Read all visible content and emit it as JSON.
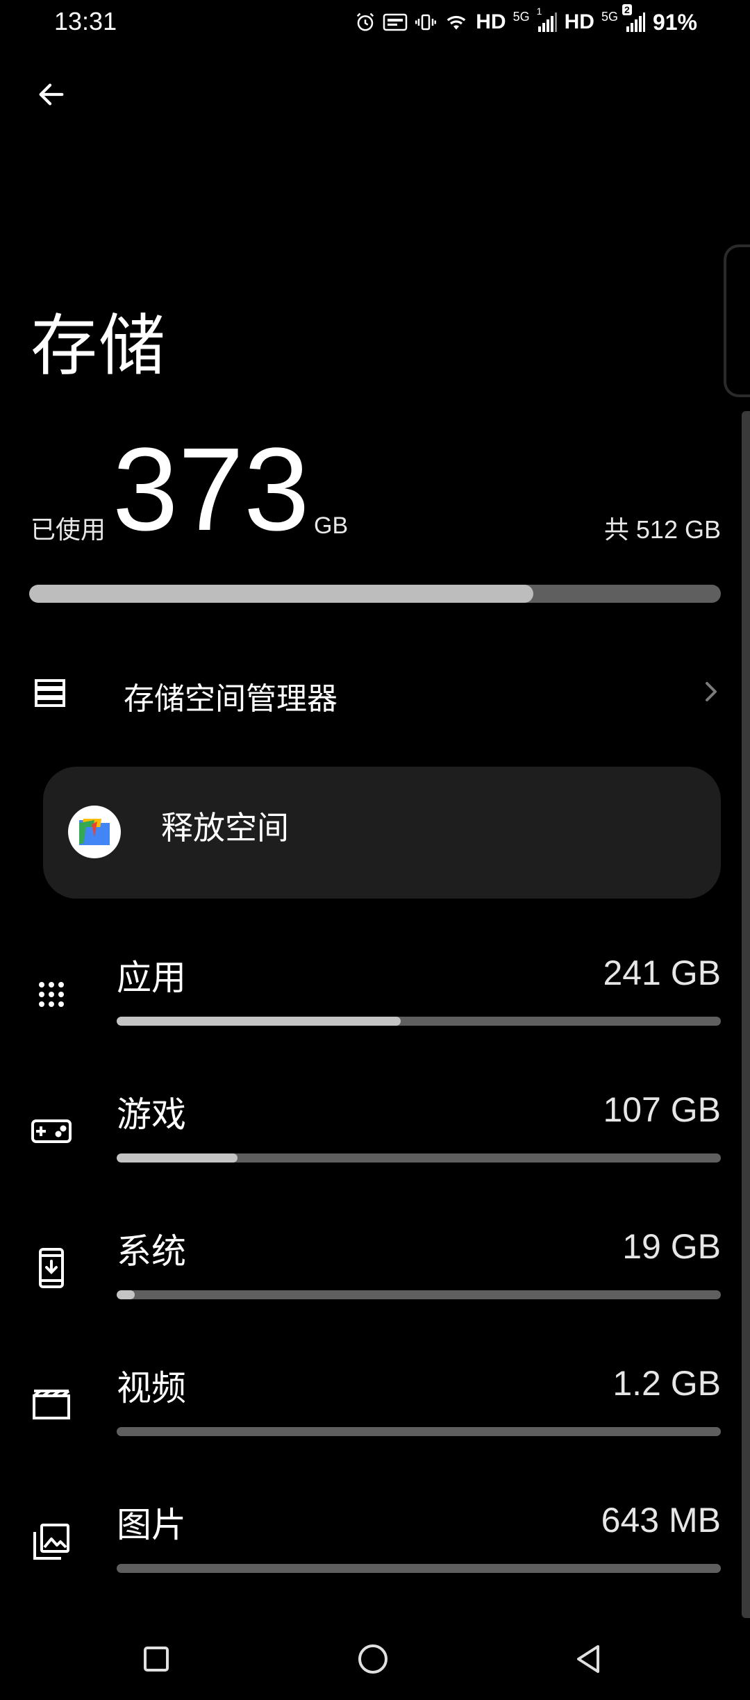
{
  "status_bar": {
    "time": "13:31",
    "hd1": "HD",
    "net1": "5G",
    "sim1": "1",
    "hd2": "HD",
    "net2": "5G",
    "sim2": "2",
    "battery": "91%"
  },
  "header": {
    "title": "存储"
  },
  "summary": {
    "used_label": "已使用",
    "used_value": "373",
    "used_unit": "GB",
    "total_label": "共 512 GB",
    "used_fraction": 0.7285
  },
  "manager": {
    "label": "存储空间管理器"
  },
  "free_space": {
    "label": "释放空间"
  },
  "categories": [
    {
      "label": "应用",
      "value": "241 GB",
      "fraction": 0.47,
      "icon": "apps-grid-icon"
    },
    {
      "label": "游戏",
      "value": "107 GB",
      "fraction": 0.2,
      "icon": "gamepad-icon"
    },
    {
      "label": "系统",
      "value": "19 GB",
      "fraction": 0.03,
      "icon": "system-update-icon"
    },
    {
      "label": "视频",
      "value": "1.2 GB",
      "fraction": 0.0,
      "icon": "movie-clapper-icon"
    },
    {
      "label": "图片",
      "value": "643 MB",
      "fraction": 0.0,
      "icon": "image-library-icon"
    }
  ],
  "colors": {
    "background": "#000000",
    "card": "#1e1e1e",
    "bar_track": "#5f5f5f",
    "bar_fill": "#bdbdbd"
  }
}
